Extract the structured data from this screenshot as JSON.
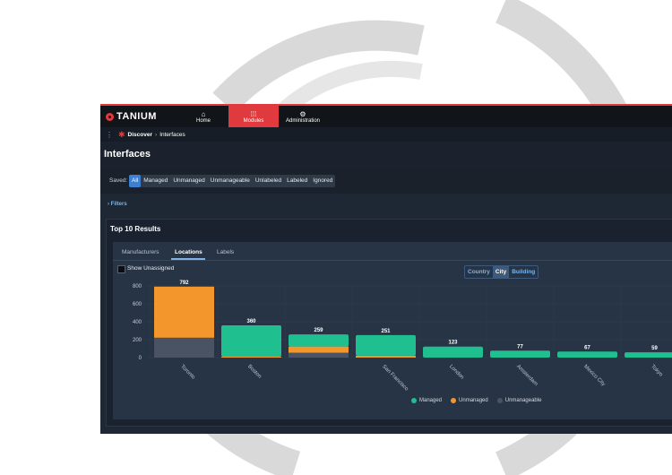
{
  "nav": {
    "logo": "TANIUM",
    "items": [
      {
        "label": "Home",
        "icon": "home-icon"
      },
      {
        "label": "Modules",
        "icon": "grid-icon"
      },
      {
        "label": "Administration",
        "icon": "gear-icon"
      }
    ]
  },
  "breadcrumb": {
    "module": "Discover",
    "page": "Interfaces"
  },
  "page_title": "Interfaces",
  "saved": {
    "label": "Saved:",
    "options": [
      "All",
      "Managed",
      "Unmanaged",
      "Unmanageable",
      "Unlabeled",
      "Labeled",
      "Ignored"
    ],
    "selected": "All"
  },
  "filters_label": "Filters",
  "results": {
    "title": "Top 10 Results",
    "tabs": [
      "Manufacturers",
      "Locations",
      "Labels"
    ],
    "active_tab": "Locations",
    "show_unassigned": "Show Unassigned",
    "groupings": [
      "Country",
      "City",
      "Building"
    ],
    "active_grouping": "City"
  },
  "colors": {
    "managed": "#1fbf8f",
    "unmanaged": "#f3972c",
    "unmanageable": "#4a5363",
    "accent": "#e03a3e",
    "link": "#7fb2e5"
  },
  "chart_data": {
    "type": "bar",
    "stacked": true,
    "categories": [
      "Toronto",
      "Boston",
      "",
      "San Francisco",
      "London",
      "Amsterdam",
      "Mexico City",
      "Tokyo"
    ],
    "totals": [
      792,
      360,
      259,
      251,
      123,
      77,
      67,
      59
    ],
    "series": [
      {
        "name": "Managed",
        "values": [
          0,
          350,
          135,
          230,
          123,
          77,
          67,
          59
        ]
      },
      {
        "name": "Unmanaged",
        "values": [
          570,
          10,
          70,
          21,
          0,
          0,
          0,
          0
        ]
      },
      {
        "name": "Unmanageable",
        "values": [
          222,
          0,
          54,
          0,
          0,
          0,
          0,
          0
        ]
      }
    ],
    "yticks": [
      0,
      200,
      400,
      600,
      800
    ],
    "ylim": [
      0,
      800
    ],
    "legend_position": "bottom"
  }
}
